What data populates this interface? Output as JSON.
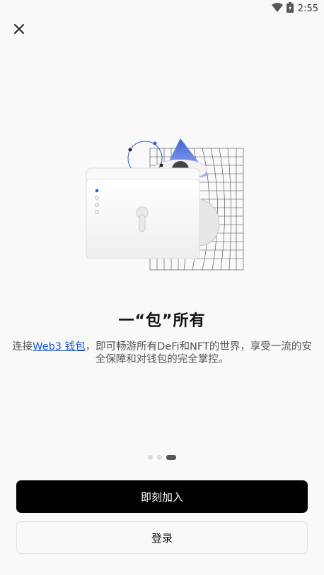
{
  "statusbar": {
    "time": "2:55",
    "icons": [
      "wifi-icon",
      "battery-charging-icon"
    ]
  },
  "nav": {
    "close_icon": "close-icon"
  },
  "onboarding": {
    "title": "一“包”所有",
    "description_prefix": "连接",
    "description_link": "Web3 钱包",
    "description_suffix": "，即可畅游所有DeFi和NFT的世界，享受一流的安全保障和对钱包的完全掌控。",
    "page_count": 3,
    "current_page": 3
  },
  "actions": {
    "primary_label": "即刻加入",
    "secondary_label": "登录"
  },
  "colors": {
    "background": "#f9f9f9",
    "primary_button": "#000000",
    "link": "#1a56d6",
    "accent_blue": "#2d5bd6"
  }
}
